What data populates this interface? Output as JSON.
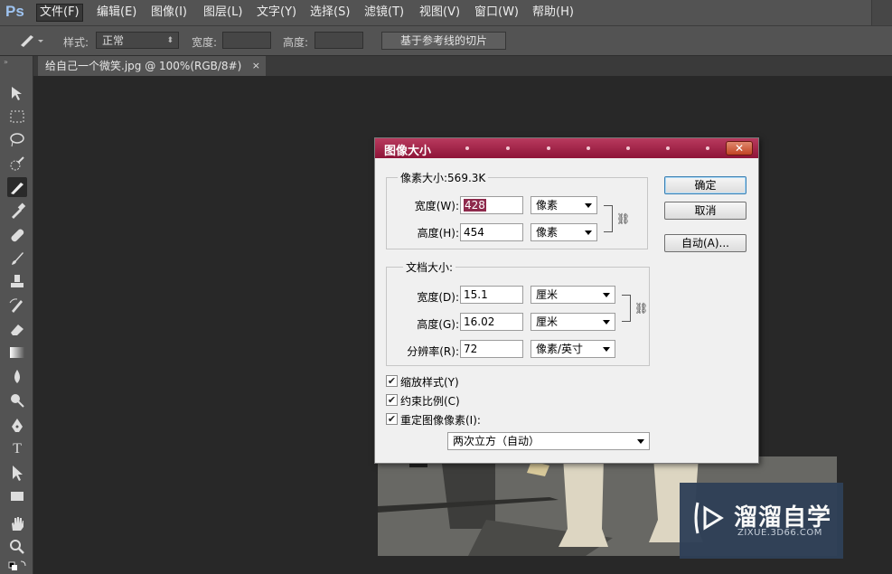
{
  "app": {
    "logo": "Ps"
  },
  "menu": {
    "items": [
      {
        "label": "文件(F)",
        "active": true
      },
      {
        "label": "编辑(E)"
      },
      {
        "label": "图像(I)"
      },
      {
        "label": "图层(L)"
      },
      {
        "label": "文字(Y)"
      },
      {
        "label": "选择(S)"
      },
      {
        "label": "滤镜(T)"
      },
      {
        "label": "视图(V)"
      },
      {
        "label": "窗口(W)"
      },
      {
        "label": "帮助(H)"
      }
    ]
  },
  "options": {
    "style_label": "样式:",
    "style_value": "正常",
    "width_label": "宽度:",
    "height_label": "高度:",
    "slice_button": "基于参考线的切片"
  },
  "tab": {
    "title": "给自己一个微笑.jpg @ 100%(RGB/8#)",
    "close": "×"
  },
  "dialog": {
    "title": "图像大小",
    "close": "✕",
    "pixel_dims": {
      "legend": "像素大小:569.3K",
      "width_label": "宽度(W):",
      "width_value": "428",
      "width_unit": "像素",
      "height_label": "高度(H):",
      "height_value": "454",
      "height_unit": "像素"
    },
    "doc_size": {
      "legend": "文档大小:",
      "width_label": "宽度(D):",
      "width_value": "15.1",
      "width_unit": "厘米",
      "height_label": "高度(G):",
      "height_value": "16.02",
      "height_unit": "厘米",
      "res_label": "分辨率(R):",
      "res_value": "72",
      "res_unit": "像素/英寸"
    },
    "checkboxes": [
      {
        "label": "缩放样式(Y)",
        "checked": true
      },
      {
        "label": "约束比例(C)",
        "checked": true
      },
      {
        "label": "重定图像像素(I):",
        "checked": true
      }
    ],
    "resample_method": "两次立方（自动）",
    "ok": "确定",
    "cancel": "取消",
    "auto": "自动(A)..."
  },
  "watermark": {
    "title": "溜溜自学",
    "url": "ZIXUE.3D66.COM"
  }
}
